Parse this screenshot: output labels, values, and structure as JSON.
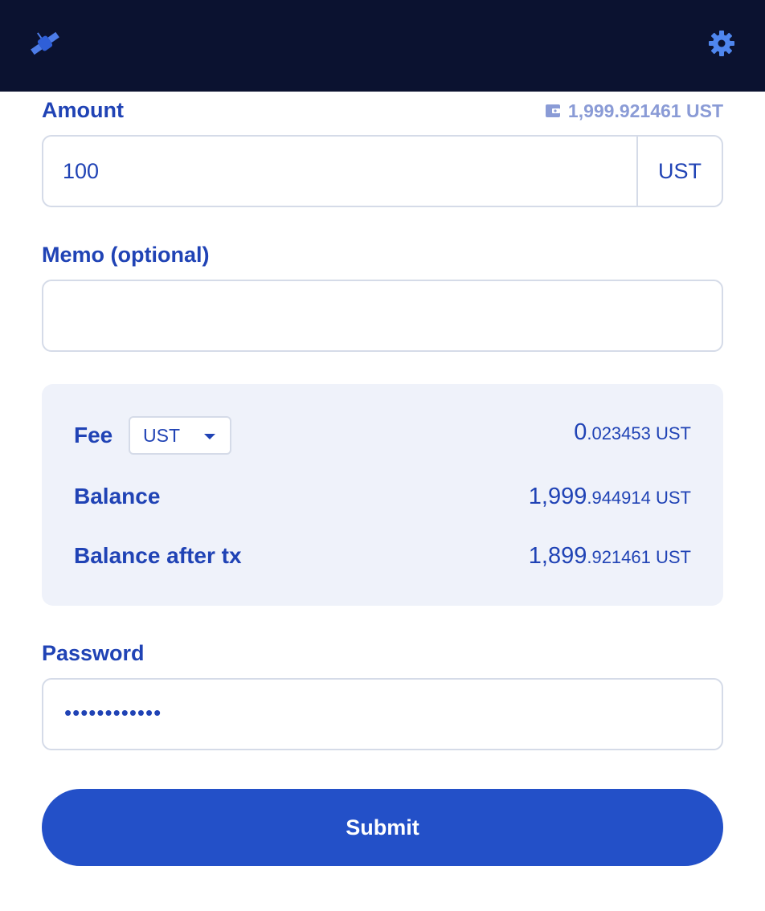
{
  "header": {
    "logo_icon": "satellite-icon",
    "settings_icon": "gear-icon"
  },
  "amount": {
    "label": "Amount",
    "available_icon": "wallet-icon",
    "available": "1,999.921461 UST",
    "value": "100",
    "unit": "UST"
  },
  "memo": {
    "label": "Memo (optional)",
    "value": ""
  },
  "summary": {
    "fee_label": "Fee",
    "fee_denom": "UST",
    "fee_int": "0",
    "fee_dec": ".023453",
    "fee_unit": "UST",
    "balance_label": "Balance",
    "balance_int": "1,999",
    "balance_dec": ".944914",
    "balance_unit": "UST",
    "after_label": "Balance after tx",
    "after_int": "1,899",
    "after_dec": ".921461",
    "after_unit": "UST"
  },
  "password": {
    "label": "Password",
    "masked": "••••••••••••"
  },
  "submit_label": "Submit",
  "colors": {
    "header_bg": "#0b1230",
    "primary": "#2043b5",
    "button": "#2350c8",
    "summary_bg": "#eff2fa"
  }
}
